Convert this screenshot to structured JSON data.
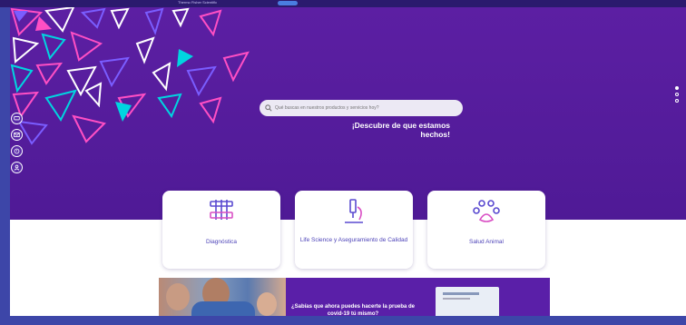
{
  "topbar": {
    "nav_text": "Thermo Fisher Scientific"
  },
  "search": {
    "placeholder": "Qué buscas en nuestros productos y servicios hoy?"
  },
  "hero": {
    "tagline": "¡Descubre de que estamos hechos!"
  },
  "carousel": {
    "slides": 3,
    "active": 0
  },
  "side_icons": [
    "chat-icon",
    "mail-icon",
    "phone-icon",
    "user-icon"
  ],
  "cards": [
    {
      "label": "Diagnóstica",
      "icon": "test-tubes-icon"
    },
    {
      "label": "Life Science y Aseguramiento de Calidad",
      "icon": "microscope-icon"
    },
    {
      "label": "Salud Animal",
      "icon": "paw-icon"
    }
  ],
  "banner": {
    "text": "¿Sabías que ahora puedes hacerte la prueba de covid-19 tú mismo?"
  },
  "colors": {
    "hero": "#5c1fa3",
    "accent": "#4d43b8",
    "frame": "#3d46a8"
  }
}
